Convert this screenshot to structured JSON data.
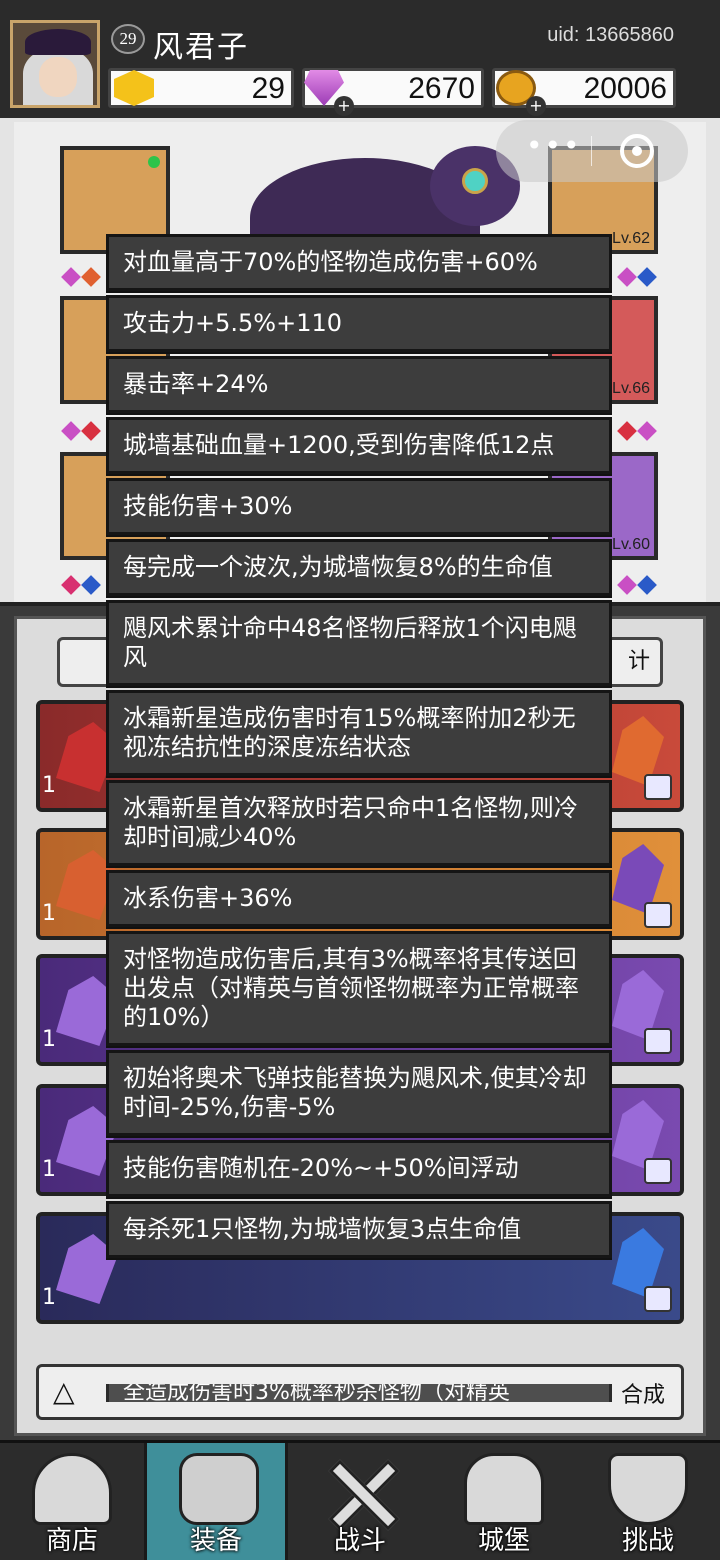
{
  "player": {
    "level": "29",
    "name": "风君子",
    "uid": "uid: 13665860"
  },
  "currencies": {
    "energy": "29",
    "gems": "2670",
    "gold": "20006"
  },
  "equipment_slots": {
    "left_top": "",
    "right_top_level": "Lv.62",
    "right_middle_level": "Lv.66",
    "right_bottom_level": "Lv.60"
  },
  "tabs": {
    "right_tab_label": "计"
  },
  "inventory_counts": [
    "1",
    "1",
    "1",
    "1",
    "1"
  ],
  "bottom_strip": {
    "synthesize_label": "合成"
  },
  "tooltip": {
    "lines": [
      "对血量高于70%的怪物造成伤害+60%",
      "攻击力+5.5%+110",
      "暴击率+24%",
      "城墙基础血量+1200,受到伤害降低12点",
      "技能伤害+30%",
      "每完成一个波次,为城墙恢复8%的生命值",
      "飓风术累计命中48名怪物后释放1个闪电飓风",
      "冰霜新星造成伤害时有15%概率附加2秒无视冻结抗性的深度冻结状态",
      "冰霜新星首次释放时若只命中1名怪物,则冷却时间减少40%",
      "冰系伤害+36%",
      "对怪物造成伤害后,其有3%概率将其传送回出发点（对精英与首领怪物概率为正常概率的10%）",
      "初始将奥术飞弹技能替换为飓风术,使其冷却时间-25%,伤害-5%",
      "技能伤害随机在-20%~+50%间浮动",
      "每杀死1只怪物,为城墙恢复3点生命值"
    ],
    "cut_off_line": "全造成伤害时3%概率秒杀怪物（对精英"
  },
  "nav": {
    "items": [
      {
        "label": "商店",
        "icon": "shop-icon"
      },
      {
        "label": "装备",
        "icon": "bag-icon"
      },
      {
        "label": "战斗",
        "icon": "crossed-swords-icon"
      },
      {
        "label": "城堡",
        "icon": "castle-icon"
      },
      {
        "label": "挑战",
        "icon": "shield-icon"
      }
    ],
    "active": "装备"
  },
  "colors": {
    "tooltip_bg": "#3d3d3d",
    "active_tab": "#3f8f9a",
    "energy": "#f4c21a",
    "gem": "#b04fc8",
    "gold": "#e7a420"
  }
}
